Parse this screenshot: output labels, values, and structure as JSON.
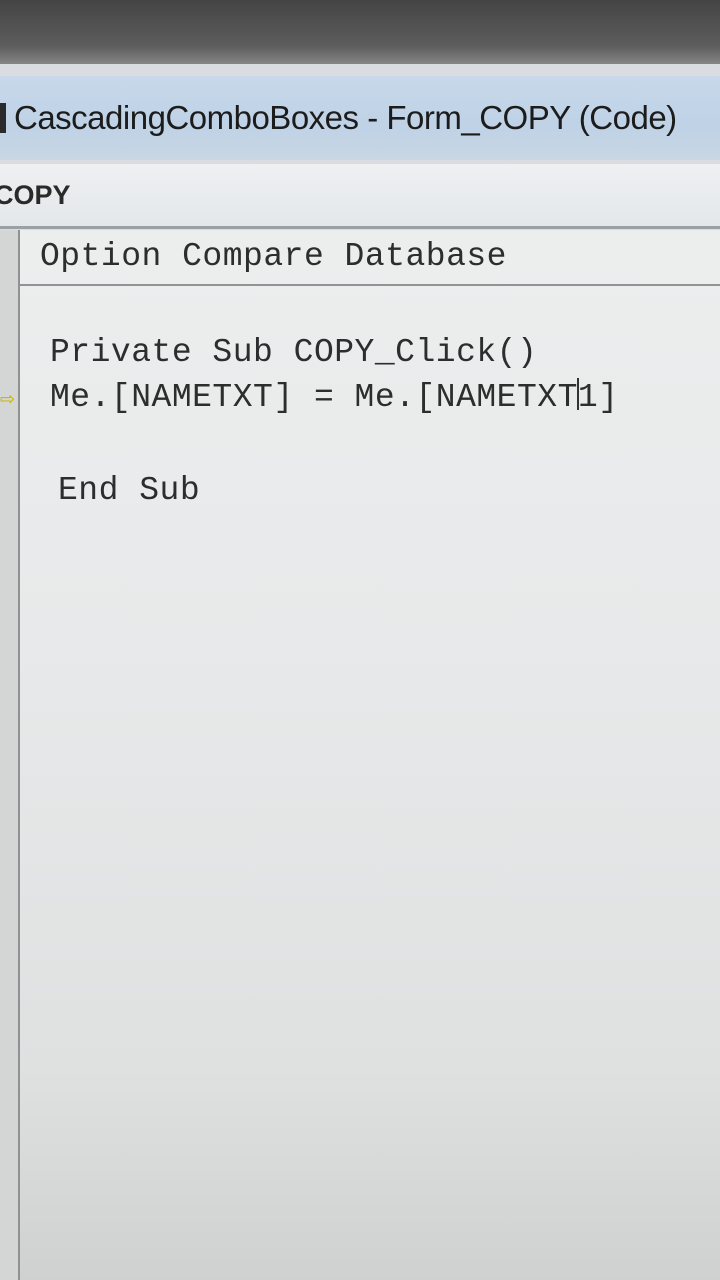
{
  "window": {
    "title": "CascadingComboBoxes - Form_COPY (Code)"
  },
  "object_bar": {
    "object": "COPY"
  },
  "code": {
    "line1": "Option Compare Database",
    "line2": "Private Sub COPY_Click()",
    "line3_before_caret": "Me.[NAMETXT] = Me.[NAMETXT",
    "line3_after_caret": "1]",
    "line4": "End Sub",
    "execution_marker": "⇨"
  },
  "colors": {
    "title_bar": "#c7d8ea",
    "editor_bg": "#eceeee",
    "code_text": "#2d2d2d",
    "exec_arrow": "#c9b000"
  }
}
